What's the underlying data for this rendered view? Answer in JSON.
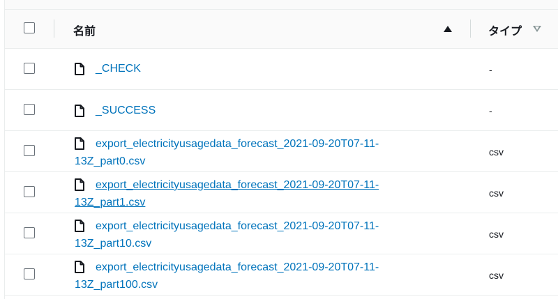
{
  "header": {
    "name_label": "名前",
    "type_label": "タイプ"
  },
  "rows": [
    {
      "name": "_CHECK",
      "type": "-"
    },
    {
      "name": "_SUCCESS",
      "type": "-"
    },
    {
      "name_line1": "export_electricityusagedata_forecast_2021-09-20T07-11-",
      "name_line2": "13Z_part0.csv",
      "type": "csv"
    },
    {
      "name_line1": "export_electricityusagedata_forecast_2021-09-20T07-11-",
      "name_line2": "13Z_part1.csv",
      "type": "csv"
    },
    {
      "name_line1": "export_electricityusagedata_forecast_2021-09-20T07-11-",
      "name_line2": "13Z_part10.csv",
      "type": "csv"
    },
    {
      "name_line1": "export_electricityusagedata_forecast_2021-09-20T07-11-",
      "name_line2": "13Z_part100.csv",
      "type": "csv"
    }
  ],
  "colors": {
    "link": "#0073bb",
    "text": "#16191f",
    "border": "#eaeded",
    "header_bg": "#fafafa"
  },
  "icons": {
    "file": "file-icon",
    "sort_ascending": "sort-ascending-icon",
    "sort_descending": "sort-descending-icon"
  }
}
